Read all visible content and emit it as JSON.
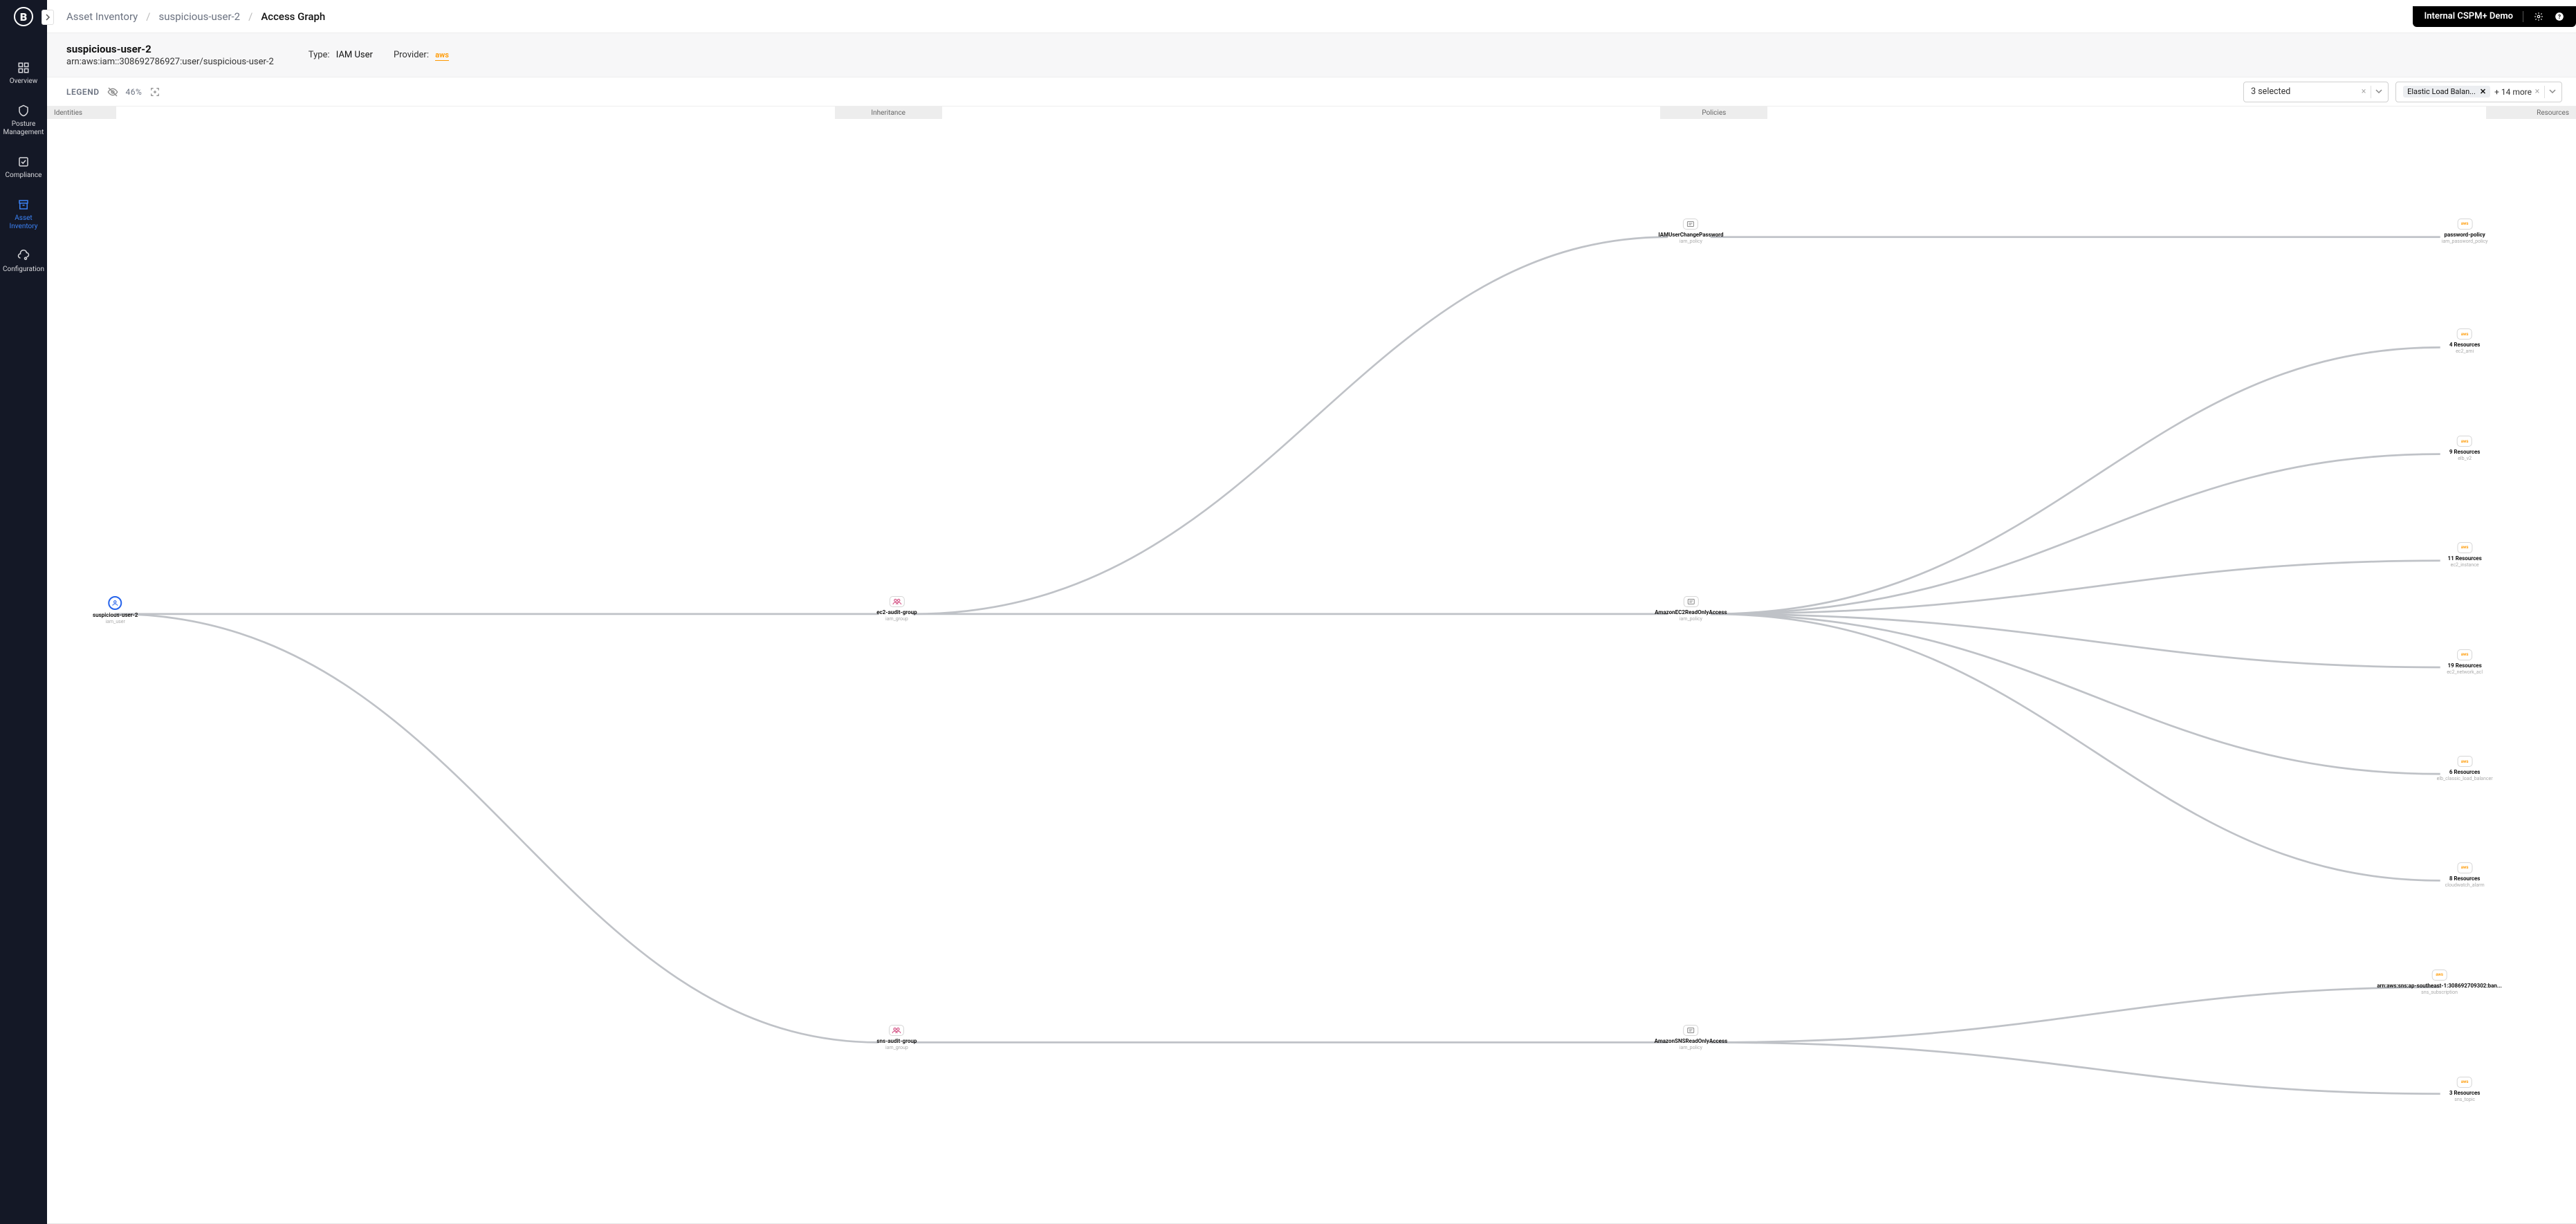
{
  "sidebar": {
    "logo_letter": "B",
    "items": [
      {
        "label": "Overview"
      },
      {
        "label": "Posture Management"
      },
      {
        "label": "Compliance"
      },
      {
        "label": "Asset Inventory"
      },
      {
        "label": "Configuration"
      }
    ]
  },
  "topbar": {
    "breadcrumbs": [
      "Asset Inventory",
      "suspicious-user-2",
      "Access Graph"
    ],
    "demo_label": "Internal CSPM+ Demo"
  },
  "resource": {
    "name": "suspicious-user-2",
    "arn": "arn:aws:iam::308692786927:user/suspicious-user-2",
    "type_label": "Type:",
    "type_value": "IAM User",
    "provider_label": "Provider:",
    "provider_value": "aws"
  },
  "toolbar": {
    "legend_label": "LEGEND",
    "zoom": "46%",
    "select1_text": "3 selected",
    "select2_chip": "Elastic Load Balan...",
    "select2_more": "+ 14 more"
  },
  "columns": {
    "identities": "Identities",
    "inheritance": "Inheritance",
    "policies": "Policies",
    "resources": "Resources"
  },
  "graph": {
    "identity": {
      "title": "suspicious-user-2",
      "sub": "iam_user"
    },
    "inheritance": [
      {
        "title": "ec2-audit-group",
        "sub": "iam_group"
      },
      {
        "title": "sns-audit-group",
        "sub": "iam_group"
      }
    ],
    "policies": [
      {
        "title": "IAMUserChangePassword",
        "sub": "iam_policy"
      },
      {
        "title": "AmazonEC2ReadOnlyAccess",
        "sub": "iam_policy"
      },
      {
        "title": "AmazonSNSReadOnlyAccess",
        "sub": "iam_policy"
      }
    ],
    "resources": [
      {
        "title": "password-policy",
        "sub": "iam_password_policy"
      },
      {
        "title": "4 Resources",
        "sub": "ec2_ami"
      },
      {
        "title": "9 Resources",
        "sub": "elb_v2"
      },
      {
        "title": "11 Resources",
        "sub": "ec2_instance"
      },
      {
        "title": "19 Resources",
        "sub": "ec2_network_acl"
      },
      {
        "title": "6 Resources",
        "sub": "elb_classic_load_balancer"
      },
      {
        "title": "8 Resources",
        "sub": "cloudwatch_alarm"
      },
      {
        "title": "arn:aws:sns:ap-southeast-1:308692709302:ban...",
        "sub": "sns_subscription"
      },
      {
        "title": "3 Resources",
        "sub": "sns_topic"
      }
    ]
  }
}
